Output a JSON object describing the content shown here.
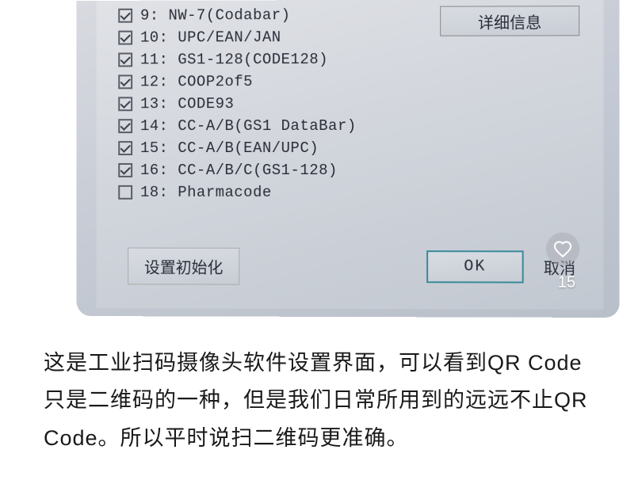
{
  "dialog": {
    "details_button": "详细信息",
    "reset_button": "设置初始化",
    "ok_button": "OK",
    "cancel_button": "取消",
    "checkboxes": [
      {
        "num": "9",
        "label": "NW-7(Codabar)",
        "checked": true
      },
      {
        "num": "10",
        "label": "UPC/EAN/JAN",
        "checked": true
      },
      {
        "num": "11",
        "label": "GS1-128(CODE128)",
        "checked": true
      },
      {
        "num": "12",
        "label": "COOP2of5",
        "checked": true
      },
      {
        "num": "13",
        "label": "CODE93",
        "checked": true
      },
      {
        "num": "14",
        "label": "CC-A/B(GS1 DataBar)",
        "checked": true
      },
      {
        "num": "15",
        "label": "CC-A/B(EAN/UPC)",
        "checked": true
      },
      {
        "num": "16",
        "label": "CC-A/B/C(GS1-128)",
        "checked": true
      },
      {
        "num": "18",
        "label": "Pharmacode",
        "checked": false
      }
    ]
  },
  "overlay": {
    "like_count": "15"
  },
  "caption": "这是工业扫码摄像头软件设置界面，可以看到QR Code只是二维码的一种，但是我们日常所用到的远远不止QR Code。所以平时说扫二维码更准确。"
}
